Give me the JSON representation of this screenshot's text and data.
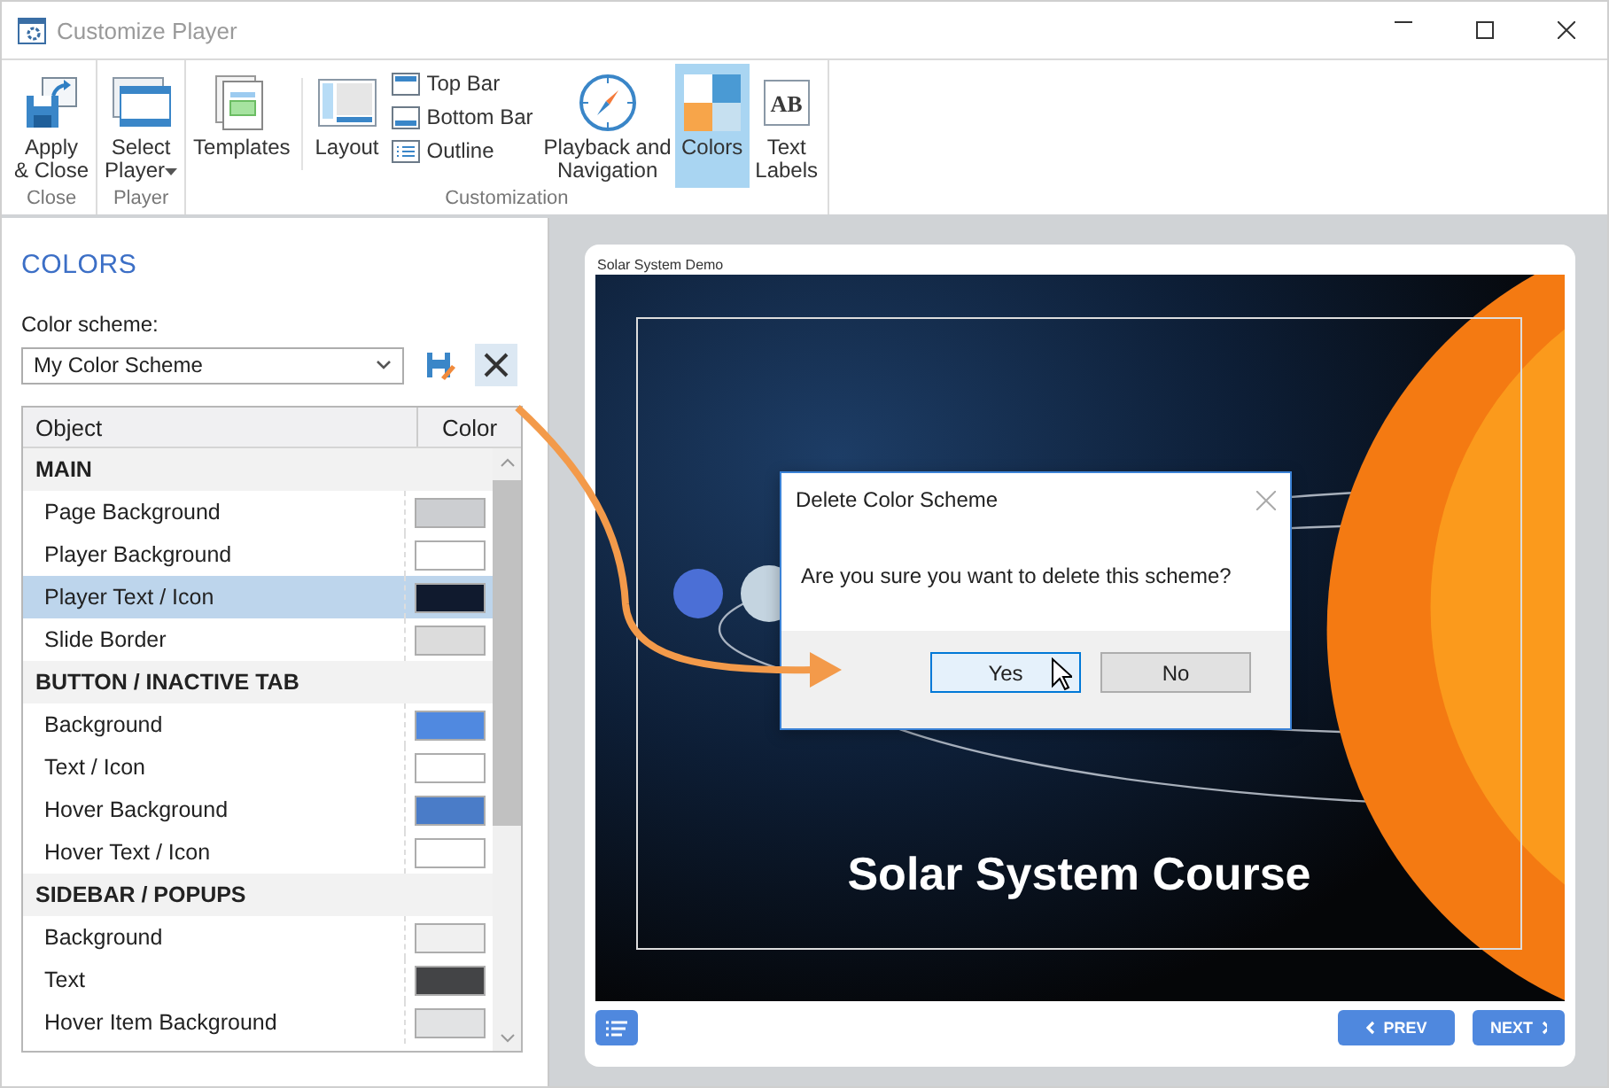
{
  "window": {
    "title": "Customize Player"
  },
  "ribbon": {
    "groups": [
      {
        "label": "Close",
        "items": [
          {
            "kind": "large",
            "label": "Apply\n& Close",
            "selected": false
          }
        ]
      },
      {
        "label": "Player",
        "items": [
          {
            "kind": "large",
            "label": "Select\nPlayer",
            "dropdown": true,
            "selected": false
          }
        ]
      },
      {
        "label": "Customization",
        "items": [
          {
            "kind": "large",
            "label": "Templates",
            "selected": false
          },
          {
            "kind": "large",
            "label": "Layout",
            "separator_before": true,
            "selected": false
          },
          {
            "kind": "stack",
            "items": [
              {
                "label": "Top Bar",
                "selected": false
              },
              {
                "label": "Bottom Bar",
                "selected": false
              },
              {
                "label": "Outline",
                "selected": false
              }
            ]
          },
          {
            "kind": "large",
            "label": "Playback and\nNavigation",
            "selected": false
          },
          {
            "kind": "large",
            "label": "Colors",
            "selected": true
          },
          {
            "kind": "large",
            "label": "Text\nLabels",
            "icon_text": "AB",
            "selected": false
          }
        ]
      }
    ]
  },
  "panel": {
    "heading": "COLORS",
    "scheme_label": "Color scheme:",
    "scheme_value": "My Color Scheme",
    "columns": [
      "Object",
      "Color"
    ],
    "sections": [
      {
        "title": "MAIN",
        "rows": [
          {
            "name": "Page Background",
            "color": "#ccced1",
            "selected": false
          },
          {
            "name": "Player Background",
            "color": "#ffffff",
            "selected": false
          },
          {
            "name": "Player Text / Icon",
            "color": "#101a2e",
            "selected": true
          },
          {
            "name": "Slide Border",
            "color": "#dcdcdc",
            "selected": false
          }
        ]
      },
      {
        "title": "BUTTON / INACTIVE TAB",
        "rows": [
          {
            "name": "Background",
            "color": "#5089e0",
            "selected": false
          },
          {
            "name": "Text / Icon",
            "color": "#ffffff",
            "selected": false
          },
          {
            "name": "Hover Background",
            "color": "#4a7cc8",
            "selected": false
          },
          {
            "name": "Hover Text / Icon",
            "color": "#ffffff",
            "selected": false
          }
        ]
      },
      {
        "title": "SIDEBAR / POPUPS",
        "rows": [
          {
            "name": "Background",
            "color": "#f0f0f0",
            "selected": false
          },
          {
            "name": "Text",
            "color": "#434446",
            "selected": false
          },
          {
            "name": "Hover Item Background",
            "color": "#e2e3e4",
            "selected": false
          }
        ]
      }
    ]
  },
  "player": {
    "title": "Solar System Demo",
    "slide_title": "Solar System Course",
    "nav_buttons": [
      {
        "kind": "prev",
        "label": "PREV"
      },
      {
        "kind": "next",
        "label": "NEXT"
      }
    ]
  },
  "dialog": {
    "title": "Delete Color Scheme",
    "message": "Are you sure you want to delete this scheme?",
    "buttons": [
      {
        "label": "Yes",
        "focused": true
      },
      {
        "label": "No",
        "focused": false
      }
    ]
  }
}
